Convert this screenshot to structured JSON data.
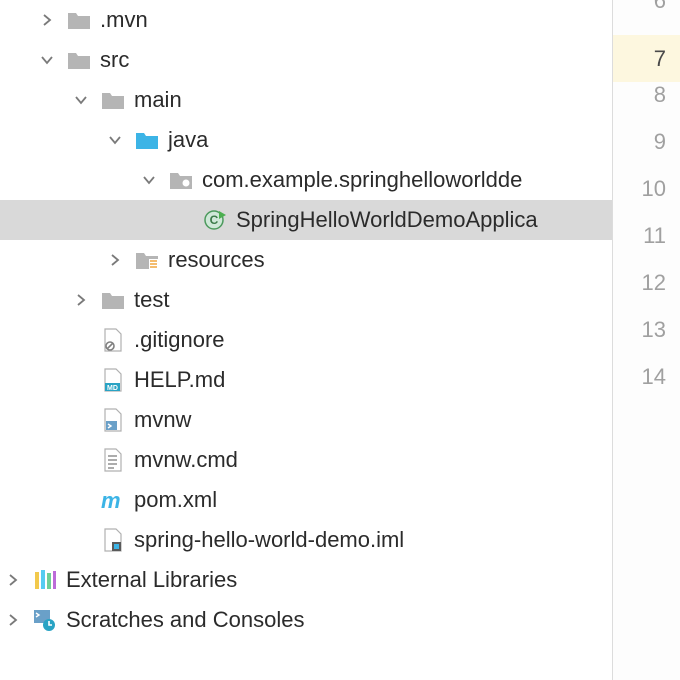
{
  "colors": {
    "folder_gray": "#b5b5b5",
    "folder_blue": "#3cb4e6",
    "selection": "#d9d9d9"
  },
  "tree": {
    "mvn": ".mvn",
    "src": "src",
    "main": "main",
    "java": "java",
    "package": "com.example.springhelloworldde",
    "app_class": "SpringHelloWorldDemoApplica",
    "resources": "resources",
    "test": "test",
    "gitignore": ".gitignore",
    "help_md": "HELP.md",
    "mvnw": "mvnw",
    "mvnw_cmd": "mvnw.cmd",
    "pom_xml": "pom.xml",
    "iml": "spring-hello-world-demo.iml",
    "ext_libs": "External Libraries",
    "scratches": "Scratches and Consoles"
  },
  "gutter": {
    "lines": [
      "6",
      "7",
      "8",
      "9",
      "10",
      "11",
      "12",
      "13",
      "14"
    ],
    "highlight_index": 1
  }
}
